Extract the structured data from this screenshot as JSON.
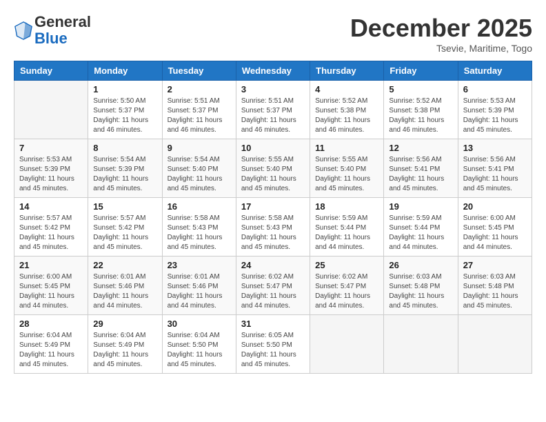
{
  "header": {
    "logo_general": "General",
    "logo_blue": "Blue",
    "month_title": "December 2025",
    "location": "Tsevie, Maritime, Togo"
  },
  "weekdays": [
    "Sunday",
    "Monday",
    "Tuesday",
    "Wednesday",
    "Thursday",
    "Friday",
    "Saturday"
  ],
  "weeks": [
    [
      {
        "day": "",
        "sunrise": "",
        "sunset": "",
        "daylight": ""
      },
      {
        "day": "1",
        "sunrise": "Sunrise: 5:50 AM",
        "sunset": "Sunset: 5:37 PM",
        "daylight": "Daylight: 11 hours and 46 minutes."
      },
      {
        "day": "2",
        "sunrise": "Sunrise: 5:51 AM",
        "sunset": "Sunset: 5:37 PM",
        "daylight": "Daylight: 11 hours and 46 minutes."
      },
      {
        "day": "3",
        "sunrise": "Sunrise: 5:51 AM",
        "sunset": "Sunset: 5:37 PM",
        "daylight": "Daylight: 11 hours and 46 minutes."
      },
      {
        "day": "4",
        "sunrise": "Sunrise: 5:52 AM",
        "sunset": "Sunset: 5:38 PM",
        "daylight": "Daylight: 11 hours and 46 minutes."
      },
      {
        "day": "5",
        "sunrise": "Sunrise: 5:52 AM",
        "sunset": "Sunset: 5:38 PM",
        "daylight": "Daylight: 11 hours and 46 minutes."
      },
      {
        "day": "6",
        "sunrise": "Sunrise: 5:53 AM",
        "sunset": "Sunset: 5:39 PM",
        "daylight": "Daylight: 11 hours and 45 minutes."
      }
    ],
    [
      {
        "day": "7",
        "sunrise": "Sunrise: 5:53 AM",
        "sunset": "Sunset: 5:39 PM",
        "daylight": "Daylight: 11 hours and 45 minutes."
      },
      {
        "day": "8",
        "sunrise": "Sunrise: 5:54 AM",
        "sunset": "Sunset: 5:39 PM",
        "daylight": "Daylight: 11 hours and 45 minutes."
      },
      {
        "day": "9",
        "sunrise": "Sunrise: 5:54 AM",
        "sunset": "Sunset: 5:40 PM",
        "daylight": "Daylight: 11 hours and 45 minutes."
      },
      {
        "day": "10",
        "sunrise": "Sunrise: 5:55 AM",
        "sunset": "Sunset: 5:40 PM",
        "daylight": "Daylight: 11 hours and 45 minutes."
      },
      {
        "day": "11",
        "sunrise": "Sunrise: 5:55 AM",
        "sunset": "Sunset: 5:40 PM",
        "daylight": "Daylight: 11 hours and 45 minutes."
      },
      {
        "day": "12",
        "sunrise": "Sunrise: 5:56 AM",
        "sunset": "Sunset: 5:41 PM",
        "daylight": "Daylight: 11 hours and 45 minutes."
      },
      {
        "day": "13",
        "sunrise": "Sunrise: 5:56 AM",
        "sunset": "Sunset: 5:41 PM",
        "daylight": "Daylight: 11 hours and 45 minutes."
      }
    ],
    [
      {
        "day": "14",
        "sunrise": "Sunrise: 5:57 AM",
        "sunset": "Sunset: 5:42 PM",
        "daylight": "Daylight: 11 hours and 45 minutes."
      },
      {
        "day": "15",
        "sunrise": "Sunrise: 5:57 AM",
        "sunset": "Sunset: 5:42 PM",
        "daylight": "Daylight: 11 hours and 45 minutes."
      },
      {
        "day": "16",
        "sunrise": "Sunrise: 5:58 AM",
        "sunset": "Sunset: 5:43 PM",
        "daylight": "Daylight: 11 hours and 45 minutes."
      },
      {
        "day": "17",
        "sunrise": "Sunrise: 5:58 AM",
        "sunset": "Sunset: 5:43 PM",
        "daylight": "Daylight: 11 hours and 45 minutes."
      },
      {
        "day": "18",
        "sunrise": "Sunrise: 5:59 AM",
        "sunset": "Sunset: 5:44 PM",
        "daylight": "Daylight: 11 hours and 44 minutes."
      },
      {
        "day": "19",
        "sunrise": "Sunrise: 5:59 AM",
        "sunset": "Sunset: 5:44 PM",
        "daylight": "Daylight: 11 hours and 44 minutes."
      },
      {
        "day": "20",
        "sunrise": "Sunrise: 6:00 AM",
        "sunset": "Sunset: 5:45 PM",
        "daylight": "Daylight: 11 hours and 44 minutes."
      }
    ],
    [
      {
        "day": "21",
        "sunrise": "Sunrise: 6:00 AM",
        "sunset": "Sunset: 5:45 PM",
        "daylight": "Daylight: 11 hours and 44 minutes."
      },
      {
        "day": "22",
        "sunrise": "Sunrise: 6:01 AM",
        "sunset": "Sunset: 5:46 PM",
        "daylight": "Daylight: 11 hours and 44 minutes."
      },
      {
        "day": "23",
        "sunrise": "Sunrise: 6:01 AM",
        "sunset": "Sunset: 5:46 PM",
        "daylight": "Daylight: 11 hours and 44 minutes."
      },
      {
        "day": "24",
        "sunrise": "Sunrise: 6:02 AM",
        "sunset": "Sunset: 5:47 PM",
        "daylight": "Daylight: 11 hours and 44 minutes."
      },
      {
        "day": "25",
        "sunrise": "Sunrise: 6:02 AM",
        "sunset": "Sunset: 5:47 PM",
        "daylight": "Daylight: 11 hours and 44 minutes."
      },
      {
        "day": "26",
        "sunrise": "Sunrise: 6:03 AM",
        "sunset": "Sunset: 5:48 PM",
        "daylight": "Daylight: 11 hours and 45 minutes."
      },
      {
        "day": "27",
        "sunrise": "Sunrise: 6:03 AM",
        "sunset": "Sunset: 5:48 PM",
        "daylight": "Daylight: 11 hours and 45 minutes."
      }
    ],
    [
      {
        "day": "28",
        "sunrise": "Sunrise: 6:04 AM",
        "sunset": "Sunset: 5:49 PM",
        "daylight": "Daylight: 11 hours and 45 minutes."
      },
      {
        "day": "29",
        "sunrise": "Sunrise: 6:04 AM",
        "sunset": "Sunset: 5:49 PM",
        "daylight": "Daylight: 11 hours and 45 minutes."
      },
      {
        "day": "30",
        "sunrise": "Sunrise: 6:04 AM",
        "sunset": "Sunset: 5:50 PM",
        "daylight": "Daylight: 11 hours and 45 minutes."
      },
      {
        "day": "31",
        "sunrise": "Sunrise: 6:05 AM",
        "sunset": "Sunset: 5:50 PM",
        "daylight": "Daylight: 11 hours and 45 minutes."
      },
      {
        "day": "",
        "sunrise": "",
        "sunset": "",
        "daylight": ""
      },
      {
        "day": "",
        "sunrise": "",
        "sunset": "",
        "daylight": ""
      },
      {
        "day": "",
        "sunrise": "",
        "sunset": "",
        "daylight": ""
      }
    ]
  ]
}
